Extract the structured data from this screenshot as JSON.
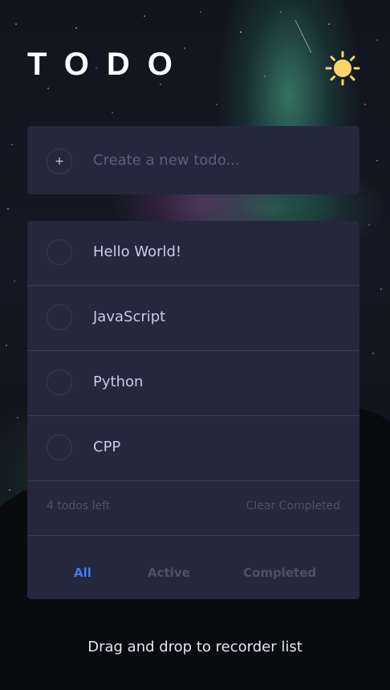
{
  "header": {
    "title": "TODO",
    "theme_toggle_icon": "sun-icon"
  },
  "new_todo": {
    "placeholder": "Create a new todo...",
    "value": "",
    "add_icon": "+"
  },
  "todos": [
    {
      "text": "Hello World!",
      "completed": false
    },
    {
      "text": "JavaScript",
      "completed": false
    },
    {
      "text": "Python",
      "completed": false
    },
    {
      "text": "CPP",
      "completed": false
    }
  ],
  "footer": {
    "items_left": "4 todos left",
    "clear_completed": "Clear Completed"
  },
  "filters": {
    "all": "All",
    "active": "Active",
    "completed": "Completed",
    "selected": "all"
  },
  "hint": "Drag and drop to recorder list",
  "colors": {
    "card": "#25273c",
    "text": "#c8cbe7",
    "muted": "#4d5067",
    "accent": "#3a7cfd",
    "sun": "#fdd568"
  }
}
